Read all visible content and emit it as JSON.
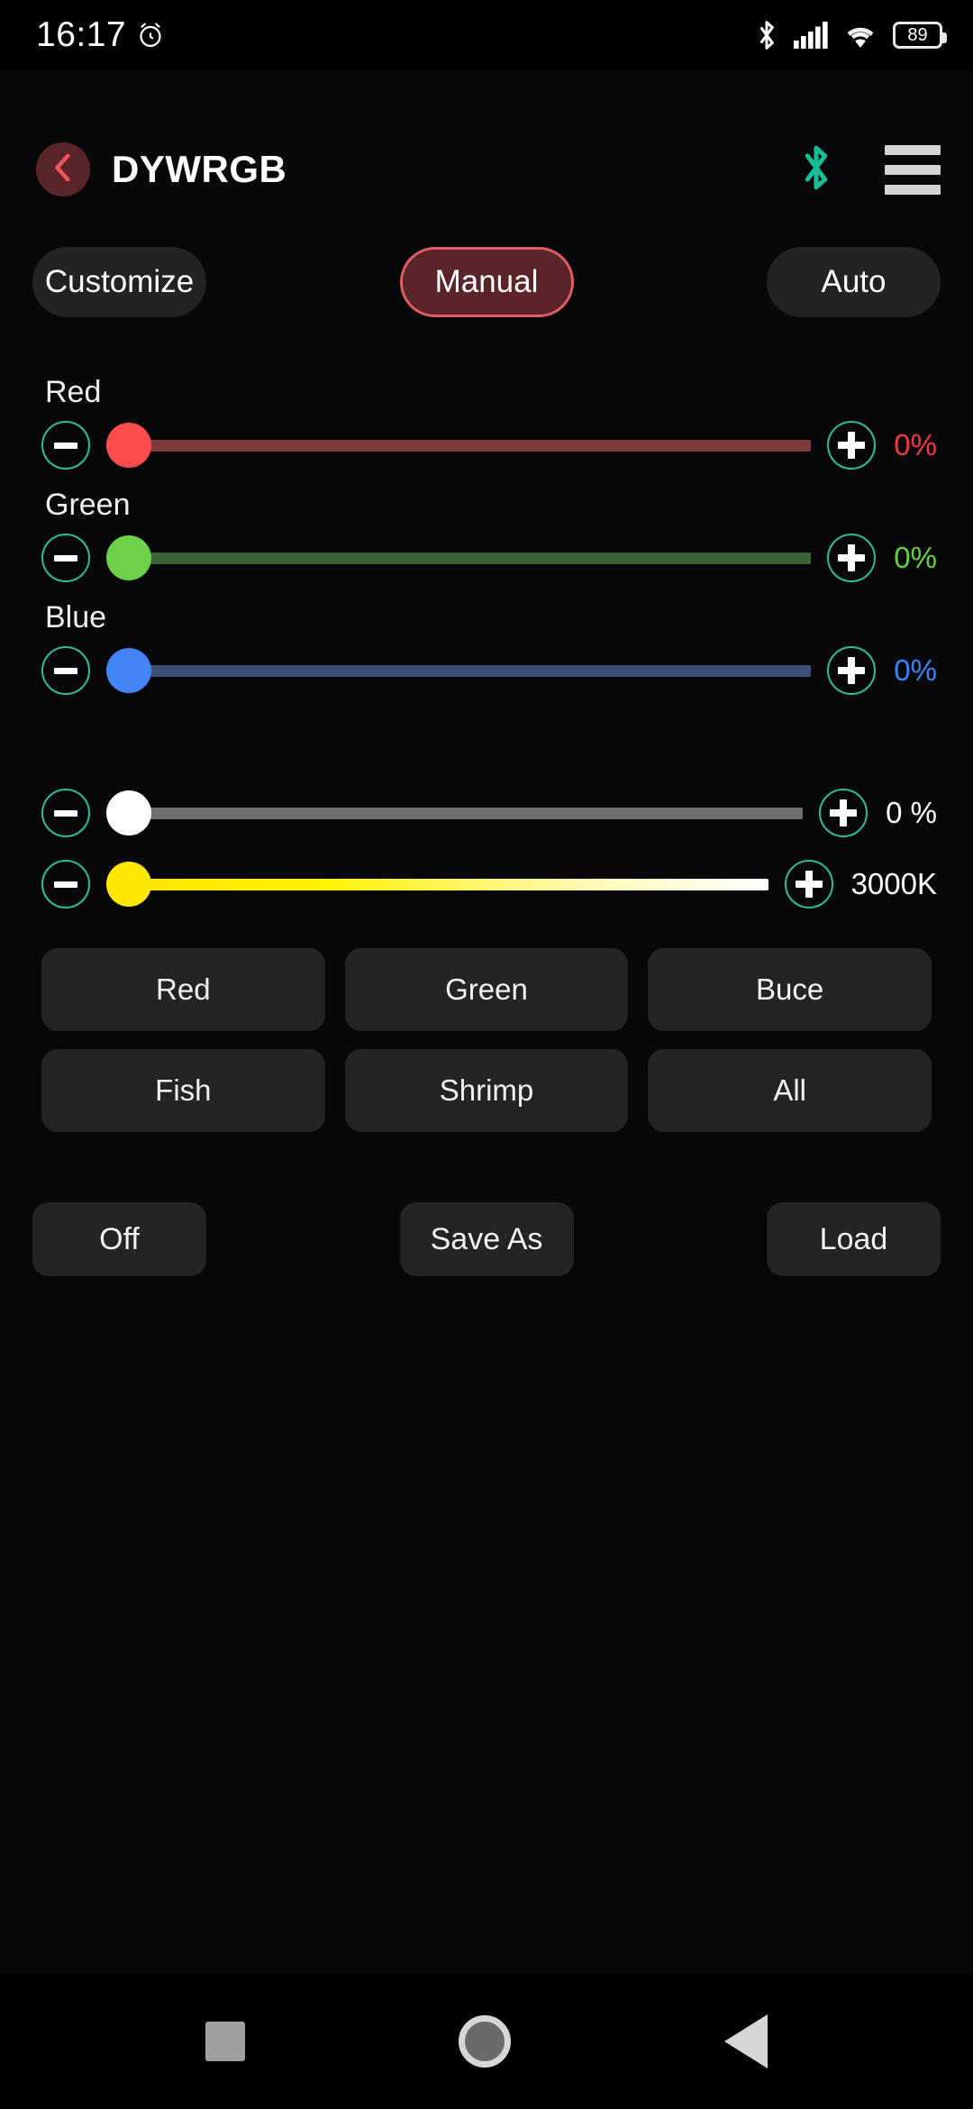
{
  "status_bar": {
    "time": "16:17",
    "alarm_icon": "alarm-icon",
    "bluetooth_icon": "bluetooth-icon",
    "signal_icon": "cellular-signal-icon",
    "wifi_icon": "wifi-icon",
    "battery_level": "89"
  },
  "header": {
    "back_icon": "back-chevron-icon",
    "title": "DYWRGB",
    "bluetooth_icon": "bluetooth-connected-icon",
    "menu_icon": "hamburger-menu-icon",
    "bluetooth_color": "#17bd96",
    "accent_color": "#e25c63"
  },
  "tabs": [
    {
      "label": "Customize",
      "active": false
    },
    {
      "label": "Manual",
      "active": true
    },
    {
      "label": "Auto",
      "active": false
    }
  ],
  "color_sliders": [
    {
      "label": "Red",
      "value": "0%",
      "percent": 0
    },
    {
      "label": "Green",
      "value": "0%",
      "percent": 0
    },
    {
      "label": "Blue",
      "value": "0%",
      "percent": 0
    }
  ],
  "extra_sliders": [
    {
      "name": "brightness",
      "value": "0 %",
      "percent": 0
    },
    {
      "name": "color-temperature",
      "value": "3000K",
      "percent": 0
    }
  ],
  "controls": {
    "minus_icon": "minus-icon",
    "plus_icon": "plus-icon"
  },
  "presets": [
    {
      "label": "Red"
    },
    {
      "label": "Green"
    },
    {
      "label": "Buce"
    },
    {
      "label": "Fish"
    },
    {
      "label": "Shrimp"
    },
    {
      "label": "All"
    }
  ],
  "actions": [
    {
      "label": "Off"
    },
    {
      "label": "Save As"
    },
    {
      "label": "Load"
    }
  ],
  "nav_bar": {
    "recents_icon": "recents-square-icon",
    "home_icon": "home-circle-icon",
    "back_icon": "back-triangle-icon"
  }
}
